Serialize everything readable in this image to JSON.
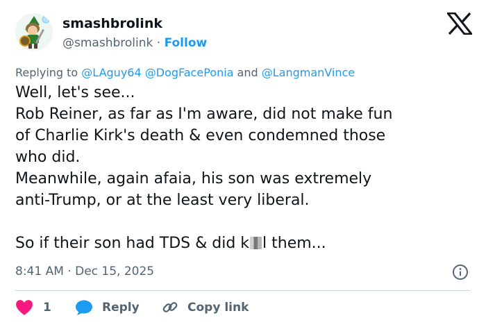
{
  "user": {
    "name": "smashbrolink",
    "handle": "@smashbrolink",
    "separator": "·",
    "follow_label": "Follow"
  },
  "reply": {
    "prefix": "Replying to",
    "mentions": [
      "@LAguy64",
      "@DogFacePonia",
      "@LangmanVince"
    ],
    "conjunction": "and"
  },
  "tweet": {
    "lines": [
      "Well, let's see...",
      "Rob Reiner, as far as I'm aware, did not make fun",
      "of Charlie Kirk's death & even condemned those",
      "who did.",
      "Meanwhile, again afaia, his son was extremely",
      "anti-Trump, or at the least very liberal.",
      ""
    ],
    "last_line_before": "So if their son had TDS & did k",
    "last_line_after": "l them..."
  },
  "meta": {
    "time": "8:41 AM",
    "separator": "·",
    "date": "Dec 15, 2025"
  },
  "actions": {
    "like_count": "1",
    "reply_label": "Reply",
    "copy_label": "Copy link"
  },
  "colors": {
    "accent": "#1d9bf0",
    "like": "#f91880",
    "muted": "#536471",
    "text": "#0f1419"
  }
}
